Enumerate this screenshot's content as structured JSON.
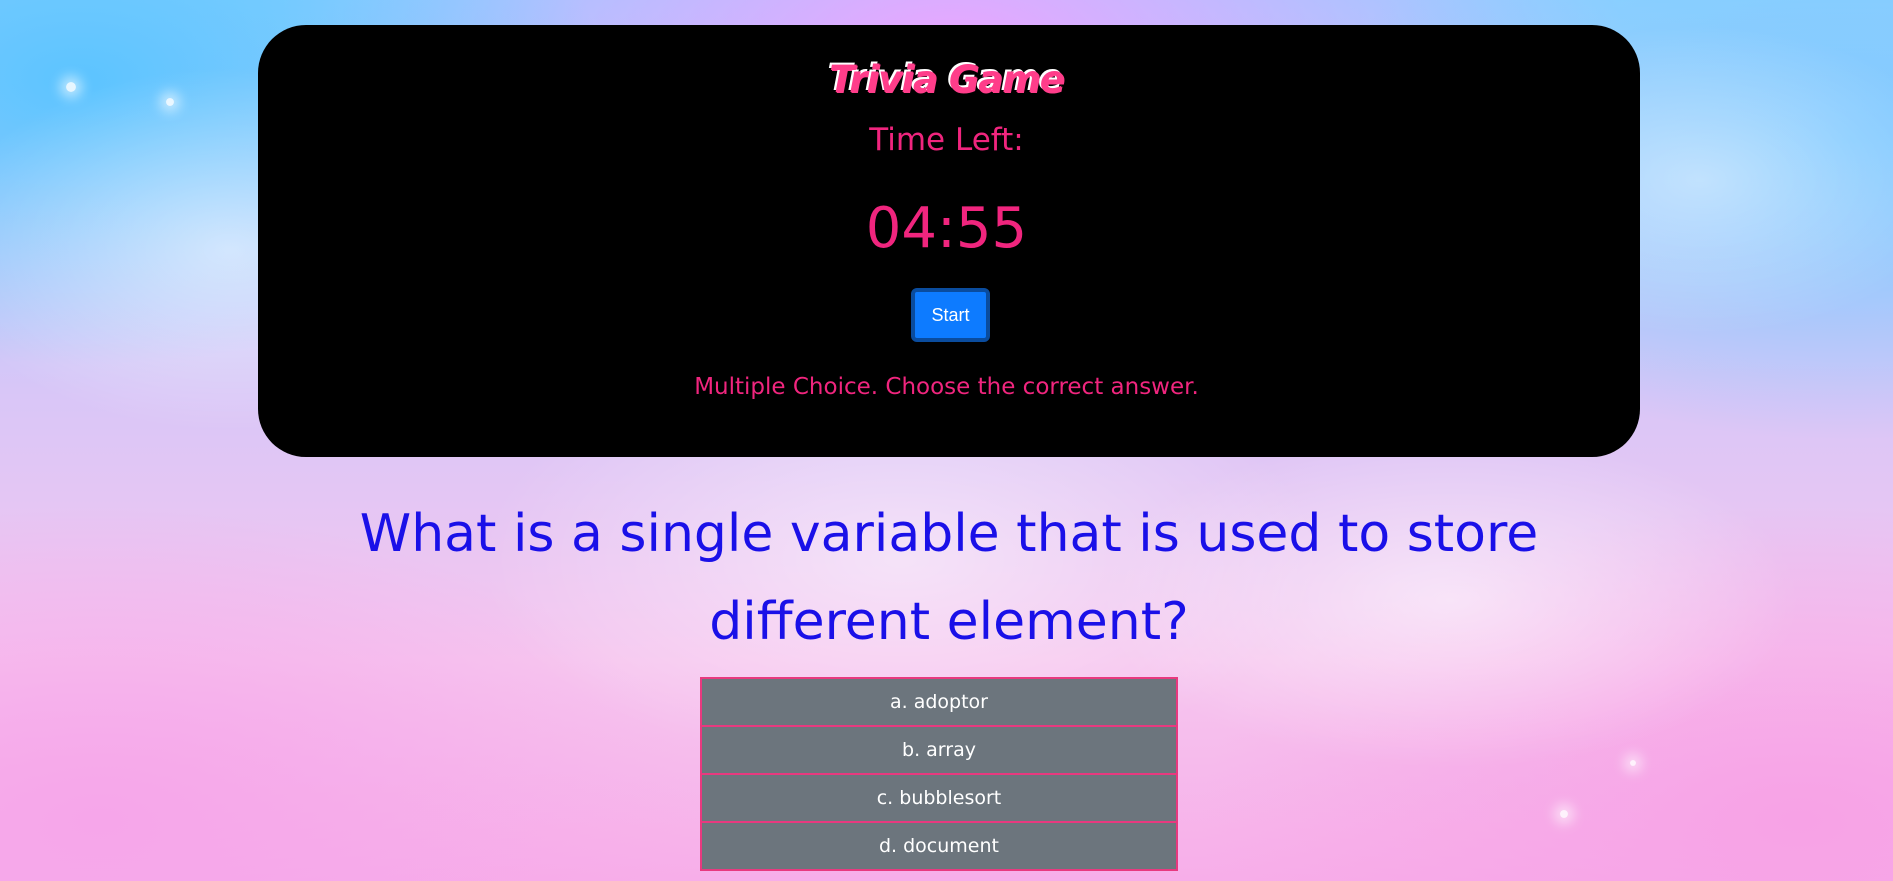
{
  "header": {
    "title": "Trivia Game",
    "time_label": "Time Left:",
    "timer": "04:55",
    "start_label": "Start",
    "instructions": "Multiple Choice. Choose the correct answer."
  },
  "question": {
    "text": "What is a single variable that is used to store different element?"
  },
  "answers": [
    {
      "label": "a. adoptor"
    },
    {
      "label": "b. array"
    },
    {
      "label": "c. bubblesort"
    },
    {
      "label": "d. document"
    }
  ],
  "colors": {
    "panel_bg": "#000000",
    "accent_pink": "#f0257e",
    "start_button": "#0d7bff",
    "question_text": "#1a10e8",
    "answer_bg": "#6c757d",
    "answer_border": "#e8397f"
  }
}
